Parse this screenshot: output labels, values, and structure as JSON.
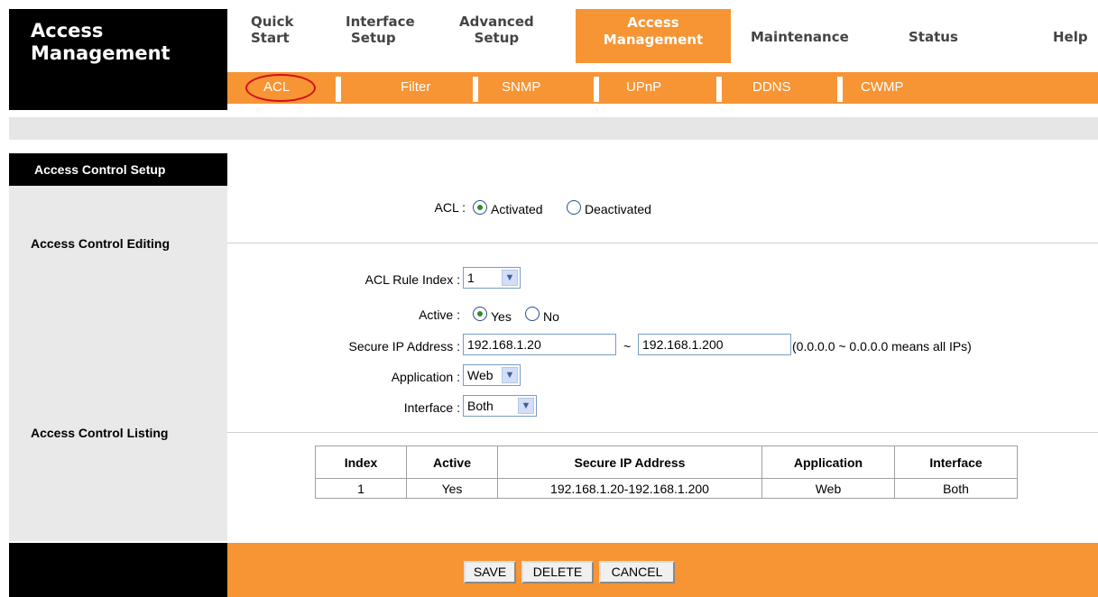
{
  "header": {
    "title_line1": "Access",
    "title_line2": "Management"
  },
  "nav": {
    "items": [
      {
        "line1": "Quick",
        "line2": "Start"
      },
      {
        "line1": "Interface",
        "line2": "Setup"
      },
      {
        "line1": "Advanced",
        "line2": "Setup"
      },
      {
        "line1": "Access",
        "line2": "Management"
      },
      {
        "line1": "Maintenance"
      },
      {
        "line1": "Status"
      },
      {
        "line1": "Help"
      }
    ]
  },
  "subnav": {
    "items": [
      "ACL",
      "Filter",
      "SNMP",
      "UPnP",
      "DDNS",
      "CWMP"
    ]
  },
  "side": {
    "setup": "Access Control Setup",
    "editing": "Access Control Editing",
    "listing": "Access Control Listing"
  },
  "form": {
    "acl_label": "ACL :",
    "activated": "Activated",
    "deactivated": "Deactivated",
    "rule_index_label": "ACL Rule Index :",
    "rule_index_value": "1",
    "active_label": "Active :",
    "yes": "Yes",
    "no": "No",
    "secure_ip_label": "Secure IP Address :",
    "ip_start": "192.168.1.20",
    "ip_sep": "~",
    "ip_end": "192.168.1.200",
    "ip_hint": "(0.0.0.0 ~ 0.0.0.0 means all IPs)",
    "application_label": "Application :",
    "application_value": "Web",
    "interface_label": "Interface :",
    "interface_value": "Both"
  },
  "table": {
    "headers": [
      "Index",
      "Active",
      "Secure IP Address",
      "Application",
      "Interface"
    ],
    "rows": [
      [
        "1",
        "Yes",
        "192.168.1.20-192.168.1.200",
        "Web",
        "Both"
      ]
    ]
  },
  "buttons": {
    "save": "SAVE",
    "delete": "DELETE",
    "cancel": "CANCEL"
  },
  "colors": {
    "accent": "#f79433",
    "highlight_circle": "#d0121b"
  }
}
